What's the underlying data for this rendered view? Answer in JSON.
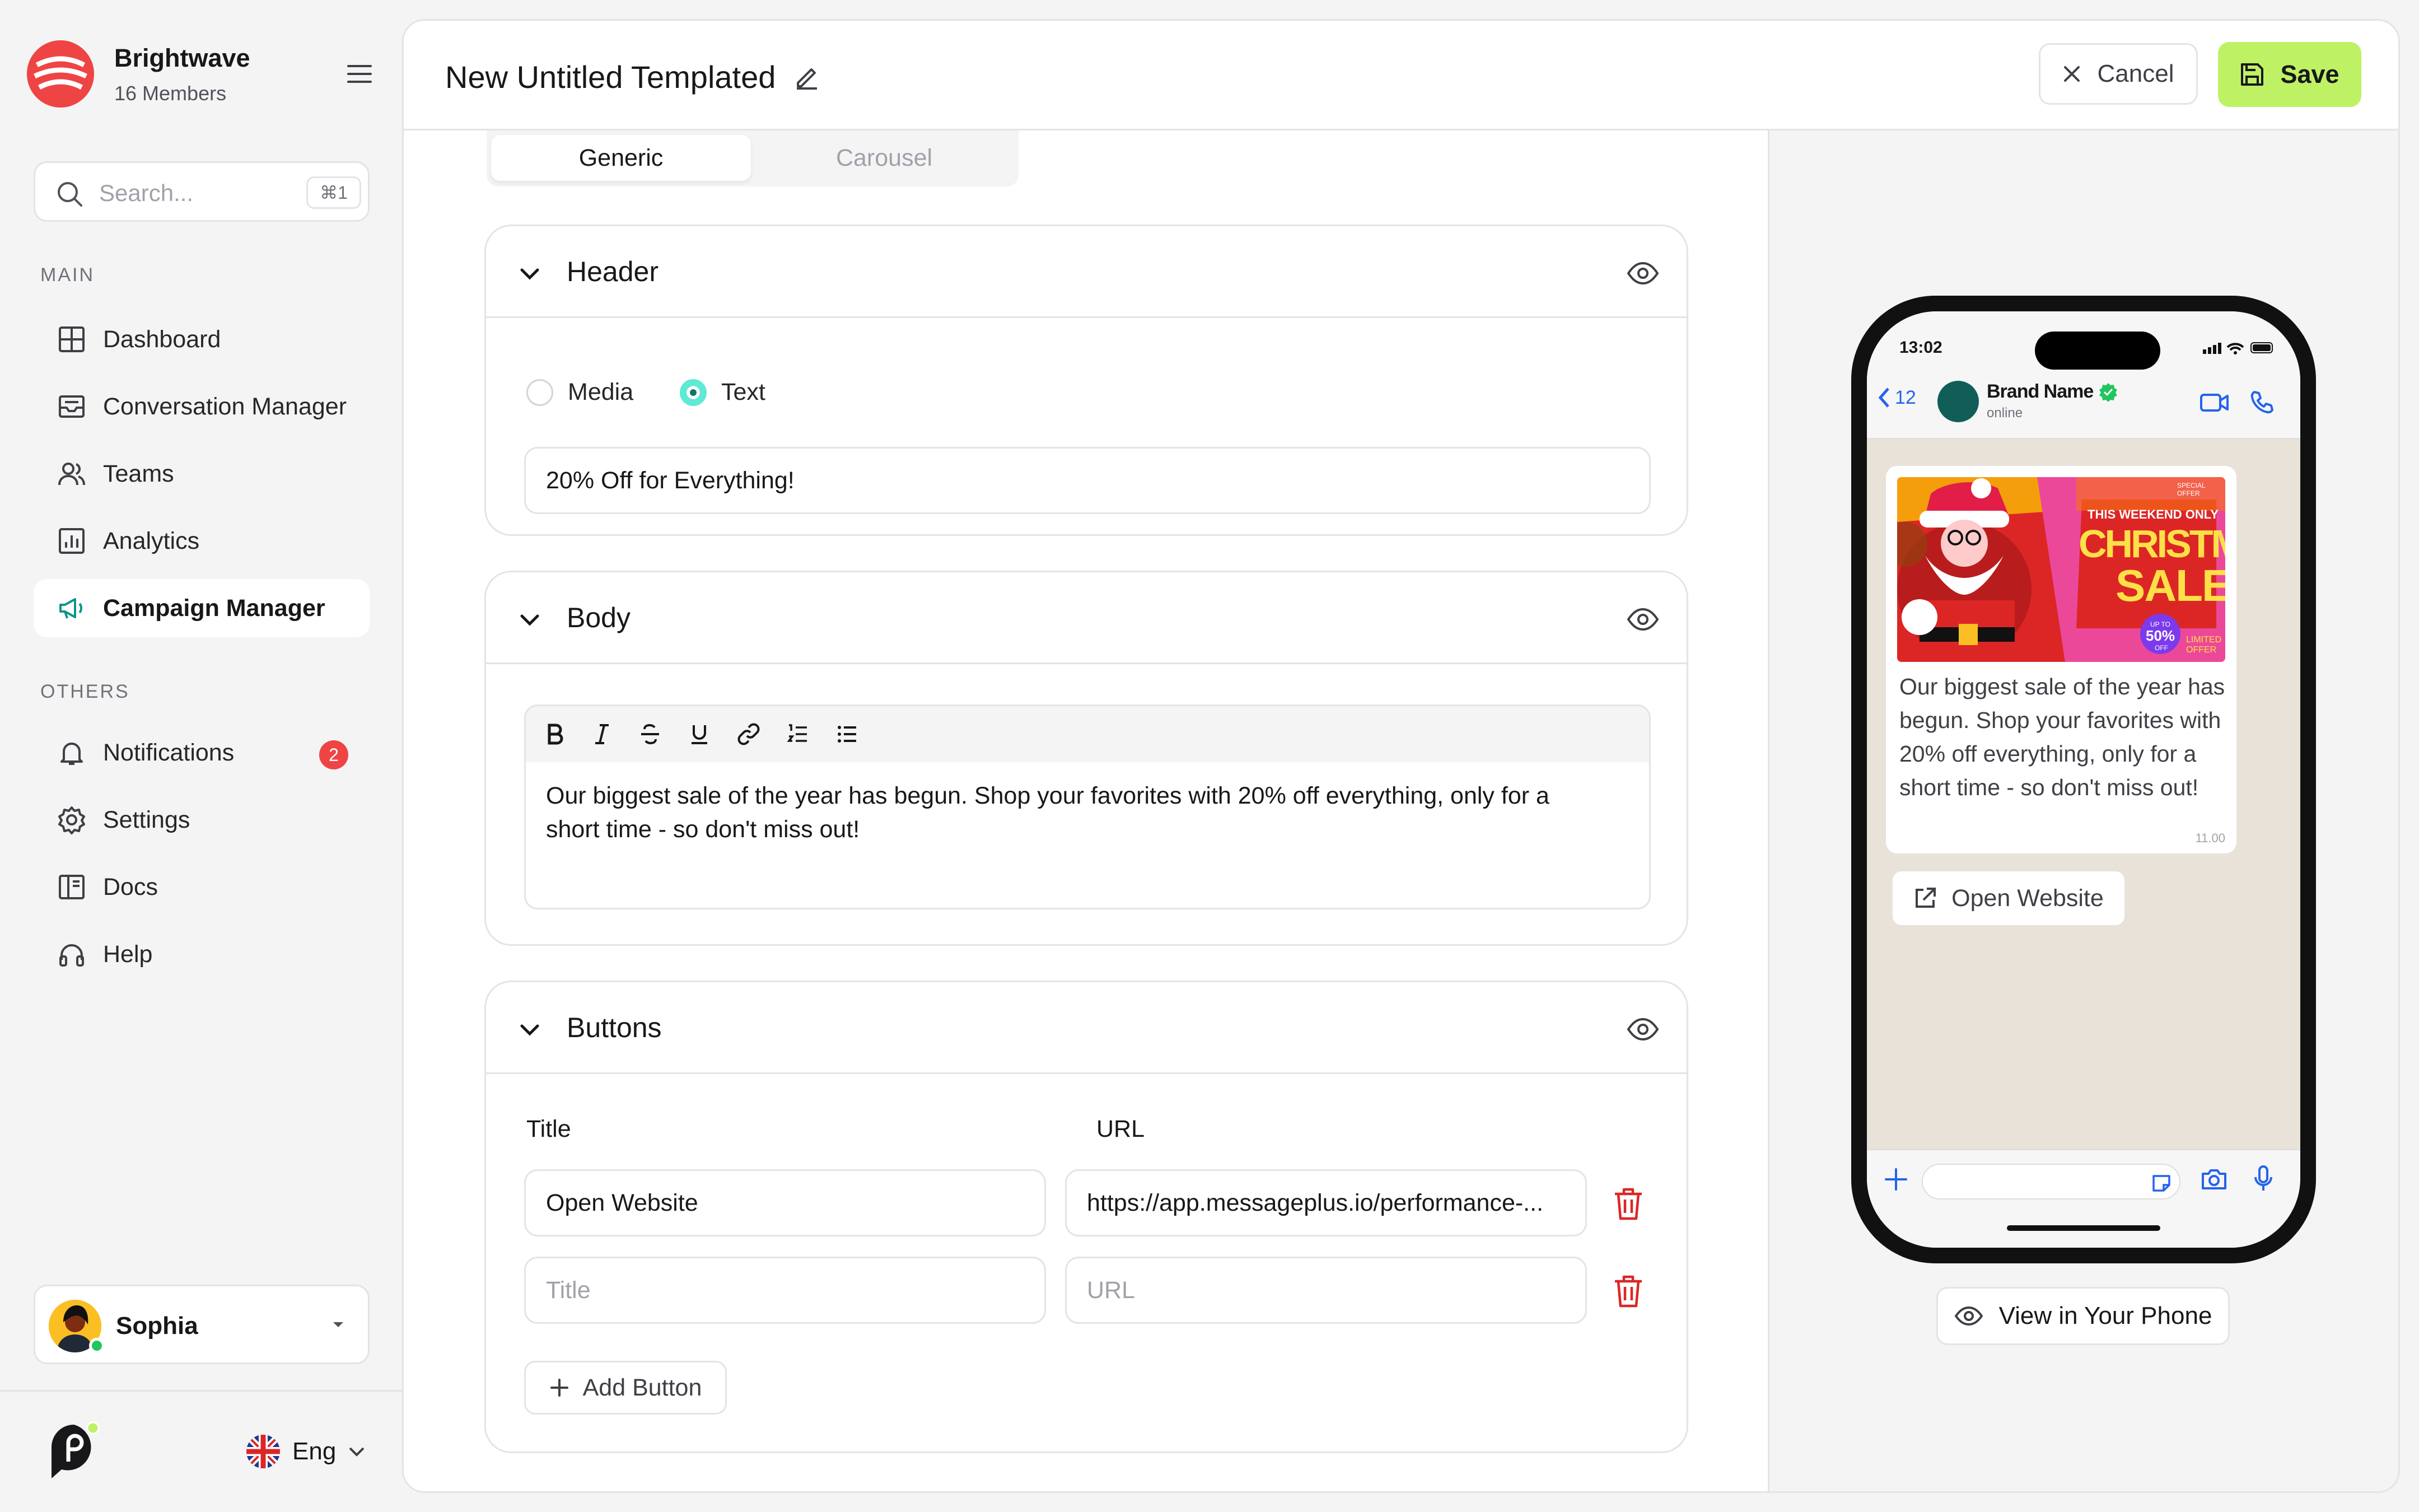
{
  "workspace": {
    "name": "Brightwave",
    "members": "16 Members"
  },
  "search": {
    "placeholder": "Search...",
    "shortcut": "⌘1"
  },
  "sections": {
    "main": "MAIN",
    "others": "OTHERS"
  },
  "nav_main": [
    "Dashboard",
    "Conversation Manager",
    "Teams",
    "Analytics",
    "Campaign Manager"
  ],
  "nav_others": [
    "Notifications",
    "Settings",
    "Docs",
    "Help"
  ],
  "notifications_count": "2",
  "user": {
    "name": "Sophia"
  },
  "language": "Eng",
  "page": {
    "title": "New Untitled Templated",
    "cancel": "Cancel",
    "save": "Save"
  },
  "tabs": [
    "Generic",
    "Carousel"
  ],
  "header_card": {
    "title": "Header",
    "options": [
      "Media",
      "Text"
    ],
    "selected": "Text",
    "value": "20% Off for Everything!"
  },
  "body_card": {
    "title": "Body",
    "text": "Our biggest sale of the year has begun. Shop your favorites with 20% off everything, only for a short time - so don't miss out!"
  },
  "buttons_card": {
    "title": "Buttons",
    "col_title": "Title",
    "col_url": "URL",
    "rows": [
      {
        "title": "Open Website",
        "url": "https://app.messageplus.io/performance-..."
      },
      {
        "title": "",
        "url": ""
      }
    ],
    "title_placeholder": "Title",
    "url_placeholder": "URL",
    "add": "Add Button"
  },
  "preview": {
    "time": "13:02",
    "back_count": "12",
    "brand": "Brand Name",
    "status": "online",
    "promo": {
      "top": "THIS WEEKEND ONLY",
      "line1": "CHRISTMAS",
      "line2": "SALE",
      "corner": "SPECIAL OFFER",
      "upto": "UP TO",
      "pct": "50%",
      "off": "OFF",
      "limited": "LIMITED OFFER"
    },
    "message": "Our biggest sale of the year has begun. Shop your favorites with 20% off everything, only for a short time - so don't miss out!",
    "timestamp": "11.00",
    "button": "Open Website",
    "view": "View in Your Phone"
  },
  "colors": {
    "accent": "#bef264",
    "brand": "#ef4444",
    "radio": "#5eead4",
    "trash": "#dc2626"
  }
}
